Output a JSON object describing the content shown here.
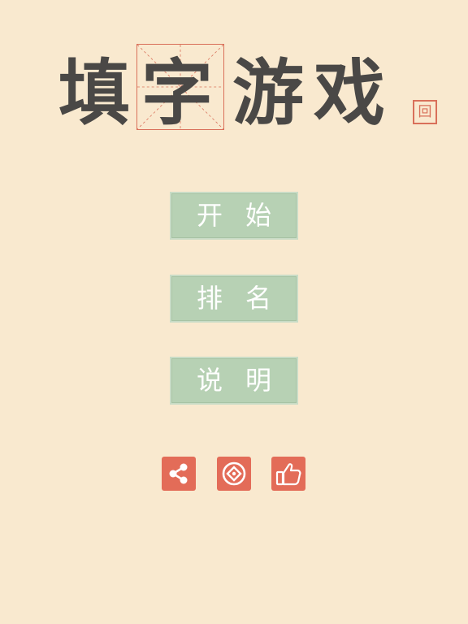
{
  "title": {
    "chars": [
      "填",
      "字",
      "游",
      "戏"
    ],
    "seal_text": "回"
  },
  "menu": {
    "start_label": "开始",
    "rank_label": "排名",
    "help_label": "说明"
  },
  "icons": {
    "share": "share-icon",
    "coin": "coin-icon",
    "like": "thumbs-up-icon"
  },
  "colors": {
    "background": "#f9e9cf",
    "title_text": "#4a4846",
    "accent_red": "#e36c58",
    "button_green": "#b7d1b4"
  }
}
